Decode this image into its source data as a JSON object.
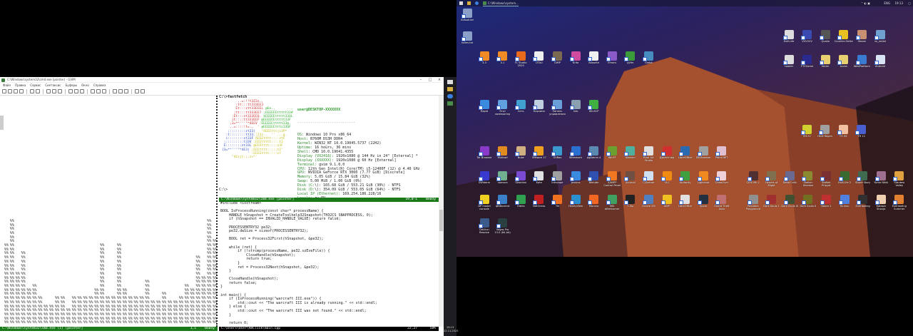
{
  "vim": {
    "title": "C:\\Windows\\system32\\cmd.exe (pointer) - GVIM",
    "menu": [
      "Файл",
      "Правка",
      "Сервис",
      "Синтаксис",
      "Буферы",
      "Окно",
      "Справка"
    ],
    "bars": {
      "glyph": "%%",
      "heights": [
        20,
        26,
        13,
        18,
        9,
        10,
        7,
        5,
        5,
        7,
        7,
        4,
        7,
        7,
        7,
        7,
        9,
        20,
        7,
        7,
        20,
        9,
        7,
        7,
        7,
        11,
        6,
        6,
        8,
        6,
        6,
        7,
        10,
        9,
        17,
        12,
        26,
        21
      ]
    },
    "left_status": {
      "name": "C:\\Windows\\system32\\cmd.exe (1) [pointer]",
      "pos": "1,1",
      "pct": "Внизу"
    },
    "term": {
      "prompt": "C:\\>fastfetch",
      "logo": [
        [
          "        ,.=:!!t3Z3z.,",
          ""
        ],
        [
          "       :tt:::tt333EE3",
          ""
        ],
        [
          "       Et:::ztt33EEEL",
          " @Ee.,      ..,"
        ],
        [
          "      ;tt:::tt333EE7",
          " ;EEEEEEttttt33#"
        ],
        [
          "     :Et:::zt333EEQ.",
          " $EEEEEttttt33QL"
        ],
        [
          "     it::::tt333EEF",
          " @EEEEEEttttt33F"
        ],
        [
          "    ;3=*^'''\"*4EEV",
          " :EEEEEEttttt33@."
        ],
        [
          "    ,.=::::!t=.,  '",
          " @EEEEEEtttz33QF"
        ],
        [
          "   ;::::::::zt33)",
          "   \"4EEEtttji3P*"
        ],
        [
          "  :t::::::::tt33.",
          ":Z3z..  '' ,..g."
        ],
        [
          "  i::::::::zt33F",
          " AEEEtttt::::ztF"
        ],
        [
          " ;:::::::::t33V",
          " ;EEEttttt::::t3"
        ],
        [
          " E::::::::zt33L",
          " @EEEtttt::::z3F"
        ],
        [
          "{3=*^'''\"*4E3)",
          " ;EEEtttt:::::tZ'"
        ],
        [
          "             '",
          " :EEEEtttt::::z7"
        ],
        [
          "",
          "     \"VEzjt:;;z>*'"
        ]
      ],
      "user": "user@DESKTOP-XXXXXXX",
      "sep": "---------------------------",
      "info": [
        "OS: Windows 10 Pro x86_64",
        "Host: B760M DS3H DDR4",
        "Kernel: WIN32_NT 10.0.19045.5737 (22H2)",
        "Uptime: 16 hours, 36 mins",
        "Shell: CMD 10.0.19041.4355",
        "Display (VX2418): 1920x1080 @ 144 Hz in 24\" [External] *",
        "Display (XXXXXX): 1920x1080 @ 60 Hz [External]",
        "Terminal: gvim 9.1.0.0",
        "CPU: 12th Gen Intel(R) Core(TM) i5-12400F (12) @ 4.40 GHz",
        "GPU: NVIDIA GeForce RTX 3060 (7.77 GiB) [Discrete]",
        "Memory: 5.05 GiB / 15.84 GiB (32%)",
        "Swap: 5.00 MiB / 1.00 GiB (0%)",
        "Disk (C:\\): 165.68 GiB / 553.21 GiB (30%) - NTFS",
        "Disk (D:\\): 354.09 GiB / 553.05 GiB (64%) - NTFS",
        "Local IP (Ethernet): 169.254.186.228/16",
        "Locale: ru-RU"
      ],
      "palette": [
        "#808080",
        "#ff0000",
        "#00ff00",
        "#ffff00",
        "#0000ff",
        "#ff00ff",
        "#00ffff",
        "#ffffff",
        "#000000"
      ],
      "prompt2": "C:\\>",
      "status": {
        "name": "C:\\Windows\\system32\\cmd.exe [pointer]",
        "pos": "19,0-1",
        "pct": "Внизу"
      }
    },
    "code": {
      "lines": [
        "#include <iostream>",
        "",
        "BOOL IsProcessRunning(const char* processName) {",
        "    HANDLE hSnapshot = CreateToolhelp32Snapshot(TH32CS_SNAPPROCESS, 0);",
        "    if (hSnapshot == INVALID_HANDLE_VALUE) return false;",
        "",
        "    PROCESSENTRY32 pe32;",
        "    pe32.dwSize = sizeof(PROCESSENTRY32);",
        "",
        "    BOOL ret = Process32First(hSnapshot, &pe32);",
        "",
        "    while (ret) {",
        "        if (!strcmp(processName, pe32.szExeFile)) {",
        "            CloseHandle(hSnapshot);",
        "            return true;",
        "        }",
        "        ret = Process32Next(hSnapshot, &pe32);",
        "    }",
        "",
        "    CloseHandle(hSnapshot);",
        "    return false;",
        "}",
        "",
        "int main() {",
        "    if (IsProcessRunning(\"warcraft III.exe\")) {",
        "        std::cout << \"The warcraft III is already running.\" << std::endl;",
        "    } else {",
        "        std::cout << \"The warcraft III was not found.\" << std::endl;",
        "    }",
        "",
        "    return 0;"
      ],
      "status": {
        "name": "C:\\Users\\User\\AHClick\\main.cpp",
        "pos": "22,27",
        "pct": "58%"
      }
    }
  },
  "vtaskbar": {
    "time": "19:13",
    "date": "22.11.2025"
  },
  "taskbar": {
    "window": "C:\\Windows\\system...",
    "lang": "ENG",
    "time": "19:13"
  },
  "desktop": {
    "g1": [
      {
        "l": "новый.txt",
        "c": "#8aa0c8"
      },
      {
        "l": "notes.txt",
        "c": "#8aa0c8"
      }
    ],
    "g2": [
      {
        "l": "3.3",
        "c": "#f08a24"
      },
      {
        "l": "4.1",
        "c": "#f08a24"
      },
      {
        "l": "FL Studio 2020",
        "c": "#e86a1a"
      },
      {
        "l": "UTAU",
        "c": "#eeeeee"
      },
      {
        "l": "GIMP",
        "c": "#7a6a50"
      },
      {
        "l": "Krita",
        "c": "#d04aa0"
      },
      {
        "l": "Aseprite",
        "c": "#f0f0f0"
      },
      {
        "l": "Emacs",
        "c": "#8a5ac8"
      },
      {
        "l": "gVim",
        "c": "#3a9a3a"
      },
      {
        "l": "Godot",
        "c": "#478cbf"
      }
    ],
    "g3a": [
      {
        "l": "Half-Life",
        "c": "#dddddd"
      },
      {
        "l": "VVVVVV",
        "c": "#3a4ab0"
      },
      {
        "l": "Quake",
        "c": "#555555"
      },
      {
        "l": "Counter-Strike",
        "c": "#e8c020"
      },
      {
        "l": "Steam",
        "c": "#c89070"
      },
      {
        "l": "vs_redist",
        "c": "#70a0d0"
      }
    ],
    "g3b": [
      {
        "l": "Loader",
        "c": "#dddddd"
      },
      {
        "l": "FTCGame",
        "c": "#2a2a90"
      },
      {
        "l": "folder",
        "c": "#e8d070"
      },
      {
        "l": "saves",
        "c": "#e8d070"
      },
      {
        "l": "WebPlatform",
        "c": "#3a7ad0"
      },
      {
        "l": "Android",
        "c": "#d8e4f4"
      }
    ],
    "g4": [
      {
        "l": "Rapid",
        "c": "#3a8ae0"
      },
      {
        "l": "Этот компьютер",
        "c": "#60a0e0"
      },
      {
        "l": "Сеть",
        "c": "#40a0d0"
      },
      {
        "l": "Корзина",
        "c": "#c0d0e0"
      },
      {
        "l": "Панель управления",
        "c": "#6aa0d8"
      },
      {
        "l": "Info",
        "c": "#8aa0b0"
      },
      {
        "l": "WinSCP",
        "c": "#40b040"
      }
    ],
    "g5": [
      {
        "l": "Tor Browser",
        "c": "#8a3ac8"
      },
      {
        "l": "Mullvad",
        "c": "#e08a20"
      },
      {
        "l": "Nuke",
        "c": "#d0b080"
      },
      {
        "l": "VMware 17",
        "c": "#f0a020"
      },
      {
        "l": "OVBox",
        "c": "#3a9ad0"
      },
      {
        "l": "Wireshark",
        "c": "#2a70d0"
      },
      {
        "l": "pgAdmin 4",
        "c": "#5a8ab0"
      },
      {
        "l": "WinFF",
        "c": "#6aa030"
      },
      {
        "l": "Neovim",
        "c": "#50b0a0"
      },
      {
        "l": "Pixel Art Studio",
        "c": "#e0e0e0"
      },
      {
        "l": "Диспетчер",
        "c": "#d03030"
      },
      {
        "l": "LibreOffice",
        "c": "#2a6ab0"
      },
      {
        "l": "DB Browser",
        "c": "#a0a0a0"
      },
      {
        "l": "Paint.NET",
        "c": "#e0c0d0"
      }
    ],
    "g6": [
      {
        "l": "SWiderm",
        "c": "#3a3ad0"
      },
      {
        "l": "nomacs",
        "c": "#70b090"
      },
      {
        "l": "Obsidian",
        "c": "#7a4ad0"
      },
      {
        "l": "Kate",
        "c": "#e0e0e0"
      },
      {
        "l": "Inkscape",
        "c": "#a0a0a0"
      },
      {
        "l": "Jenkins",
        "c": "#3a8ae0"
      },
      {
        "l": "Blender",
        "c": "#3050b0"
      },
      {
        "l": "XAMPP Control Panel",
        "c": "#f07820"
      },
      {
        "l": "Xournal",
        "c": "#705040"
      },
      {
        "l": "CCleaner",
        "c": "#d0e0f0"
      },
      {
        "l": "VLC",
        "c": "#f08a10"
      },
      {
        "l": "Audacity",
        "c": "#40a040"
      },
      {
        "l": "Lightshot",
        "c": "#f08a20"
      },
      {
        "l": "CrossOver",
        "c": "#f0d0d8"
      }
    ],
    "g7": [
      {
        "l": "DP model console",
        "c": "#f0d020"
      },
      {
        "l": "qBittorrent",
        "c": "#3a80c8"
      },
      {
        "l": "Orbits",
        "c": "#30a050"
      },
      {
        "l": "NetChess",
        "c": "#c02020"
      },
      {
        "l": "7N",
        "c": "#f07020"
      },
      {
        "l": "HoneyView",
        "c": "#2a90d0"
      },
      {
        "l": "Monero",
        "c": "#f26822"
      },
      {
        "l": "MSI Afterburner",
        "c": "#40a060"
      },
      {
        "l": "7-Zip",
        "c": "#222222"
      },
      {
        "l": "Oracle VM",
        "c": "#5080c0"
      },
      {
        "l": "AIMP",
        "c": "#f0c020"
      },
      {
        "l": "LibreOffice",
        "c": "#e0e0e0"
      },
      {
        "l": "Spore",
        "c": "#223040"
      },
      {
        "l": "Grand Theft Auto",
        "c": "#c07070"
      }
    ],
    "g8": [
      {
        "l": "DaVinci Resolve",
        "c": "#3a5a8a"
      },
      {
        "l": "Vegas Pro 13.0 (64-bit)",
        "c": "#2a4040"
      }
    ],
    "g9": [
      {
        "l": "TES IV",
        "c": "#d0d030"
      },
      {
        "l": "HDD Regen",
        "c": "#a0a0a0"
      },
      {
        "l": "TH 06",
        "c": "#f0c0a0"
      },
      {
        "l": "TH 11",
        "c": "#4a60d0"
      }
    ],
    "g10": [
      {
        "l": "DOS Mk 2",
        "c": "#503030"
      },
      {
        "l": "Heroes of Might",
        "c": "#807050"
      },
      {
        "l": "Dead Cells",
        "c": "#6a6a90"
      },
      {
        "l": "Stalker Shadow",
        "c": "#8a8a30"
      },
      {
        "l": "Stalker Pripyat",
        "c": "#7a3030"
      },
      {
        "l": "Half-Life 2",
        "c": "#3a6a30"
      },
      {
        "l": "Stone Story",
        "c": "#406a50"
      },
      {
        "l": "Yume Nikki",
        "c": "#a07090"
      },
      {
        "l": "Stardew Valley",
        "c": "#e0a040"
      }
    ],
    "g11": [
      {
        "l": "Resident Playground",
        "c": "#909090"
      },
      {
        "l": "Dark Souls 1",
        "c": "#a03030"
      },
      {
        "l": "Dark Souls III",
        "c": "#405030"
      },
      {
        "l": "Dark Souls II",
        "c": "#707020"
      },
      {
        "l": "Doom 2",
        "c": "#c03030"
      },
      {
        "l": "Touhou",
        "c": "#5080e0"
      },
      {
        "l": "Everlasting",
        "c": "#303030"
      },
      {
        "l": "Katawa Shoujo",
        "c": "#f0d0b0"
      },
      {
        "l": "Everlasting Summer",
        "c": "#e08030"
      }
    ]
  }
}
